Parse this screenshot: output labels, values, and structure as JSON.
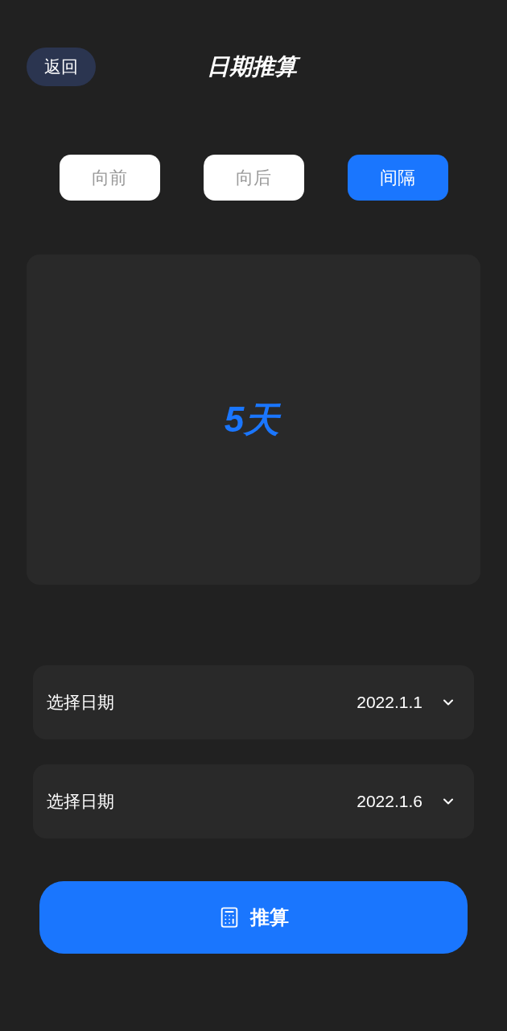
{
  "header": {
    "back_button": "返回",
    "title": "日期推算"
  },
  "tabs": [
    {
      "label": "向前",
      "selected": false
    },
    {
      "label": "向后",
      "selected": false
    },
    {
      "label": "间隔",
      "selected": true
    }
  ],
  "result": {
    "value": "5天"
  },
  "date_fields": [
    {
      "label": "选择日期",
      "value": "2022.1.1"
    },
    {
      "label": "选择日期",
      "value": "2022.1.6"
    }
  ],
  "action_button": {
    "label": "推算"
  }
}
